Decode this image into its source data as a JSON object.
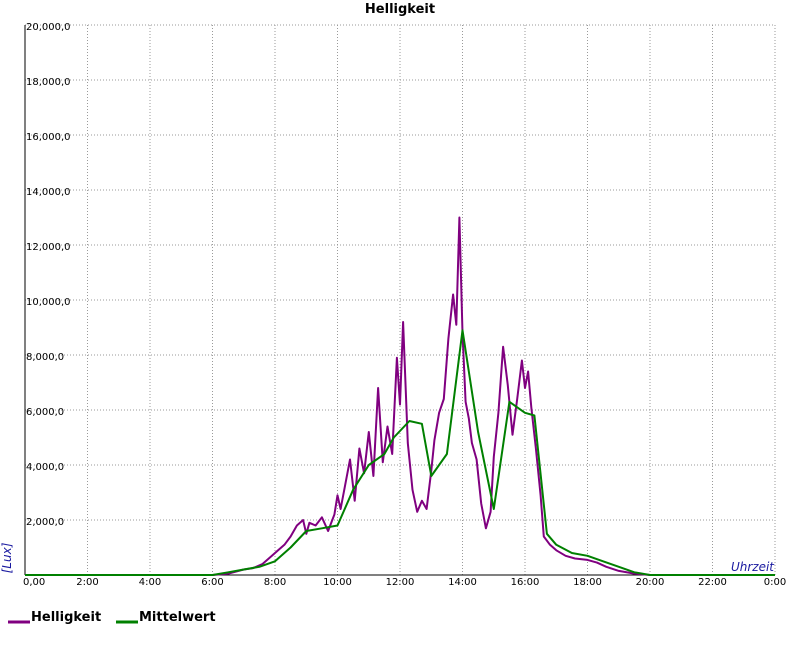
{
  "chart_data": {
    "type": "line",
    "title": "Helligkeit",
    "xlabel": "Uhrzeit",
    "ylabel": "[Lux]",
    "x_ticks": [
      "0,00",
      "2:00",
      "4:00",
      "6:00",
      "8:00",
      "10:00",
      "12:00",
      "14:00",
      "16:00",
      "18:00",
      "20:00",
      "22:00",
      "0:00"
    ],
    "y_ticks": [
      "2,000,0",
      "4,000,0",
      "6,000,0",
      "8,000,0",
      "10,000,0",
      "12,000,0",
      "14,000,0",
      "16,000,0",
      "18,000,0",
      "20,000,0"
    ],
    "xlim": [
      0,
      24
    ],
    "ylim": [
      0,
      20000
    ],
    "grid": true,
    "legend_position": "bottom-left",
    "series": [
      {
        "name": "Helligkeit",
        "color": "#800080",
        "x": [
          0,
          5.5,
          6.0,
          6.5,
          7.0,
          7.3,
          7.6,
          7.9,
          8.1,
          8.3,
          8.5,
          8.7,
          8.9,
          9.0,
          9.1,
          9.3,
          9.5,
          9.7,
          9.9,
          10.0,
          10.1,
          10.25,
          10.4,
          10.55,
          10.7,
          10.85,
          11.0,
          11.15,
          11.3,
          11.45,
          11.6,
          11.75,
          11.9,
          12.0,
          12.1,
          12.25,
          12.4,
          12.55,
          12.7,
          12.85,
          13.0,
          13.1,
          13.25,
          13.4,
          13.55,
          13.7,
          13.8,
          13.9,
          14.0,
          14.1,
          14.2,
          14.3,
          14.45,
          14.6,
          14.75,
          14.9,
          15.0,
          15.15,
          15.3,
          15.45,
          15.6,
          15.75,
          15.9,
          16.0,
          16.1,
          16.2,
          16.35,
          16.5,
          16.6,
          16.8,
          17.0,
          17.3,
          17.6,
          18.0,
          18.3,
          18.6,
          19.0,
          19.5,
          20.0,
          20.5,
          21.0,
          24.0
        ],
        "values": [
          0,
          0,
          0,
          50,
          200,
          250,
          400,
          700,
          900,
          1100,
          1400,
          1800,
          2000,
          1500,
          1900,
          1800,
          2100,
          1600,
          2200,
          2900,
          2400,
          3300,
          4200,
          2700,
          4600,
          3700,
          5200,
          3600,
          6800,
          4100,
          5400,
          4400,
          7900,
          6200,
          9200,
          4800,
          3100,
          2300,
          2700,
          2400,
          3800,
          4900,
          5900,
          6400,
          8600,
          10200,
          9100,
          13000,
          8800,
          6300,
          5700,
          4800,
          4200,
          2600,
          1700,
          2300,
          4300,
          5900,
          8300,
          6900,
          5100,
          6400,
          7800,
          6800,
          7400,
          6100,
          4600,
          2900,
          1400,
          1100,
          900,
          700,
          600,
          550,
          450,
          300,
          150,
          50,
          0,
          0,
          0,
          0
        ]
      },
      {
        "name": "Mittelwert",
        "color": "#008000",
        "x": [
          0,
          5.5,
          6.0,
          6.5,
          7.0,
          7.5,
          8.0,
          8.5,
          9.0,
          9.5,
          10.0,
          10.5,
          11.0,
          11.5,
          11.8,
          12.3,
          12.7,
          13.0,
          13.5,
          14.0,
          14.5,
          15.0,
          15.5,
          16.0,
          16.3,
          16.7,
          17.0,
          17.5,
          18.0,
          18.5,
          19.0,
          19.5,
          20.0,
          20.5,
          21.0,
          24.0
        ],
        "values": [
          0,
          0,
          0,
          100,
          200,
          300,
          500,
          1000,
          1600,
          1700,
          1800,
          3100,
          4000,
          4400,
          5000,
          5600,
          5500,
          3600,
          4400,
          8900,
          5200,
          2400,
          6300,
          5900,
          5800,
          1500,
          1100,
          800,
          700,
          500,
          300,
          100,
          0,
          0,
          0,
          0
        ]
      }
    ]
  }
}
